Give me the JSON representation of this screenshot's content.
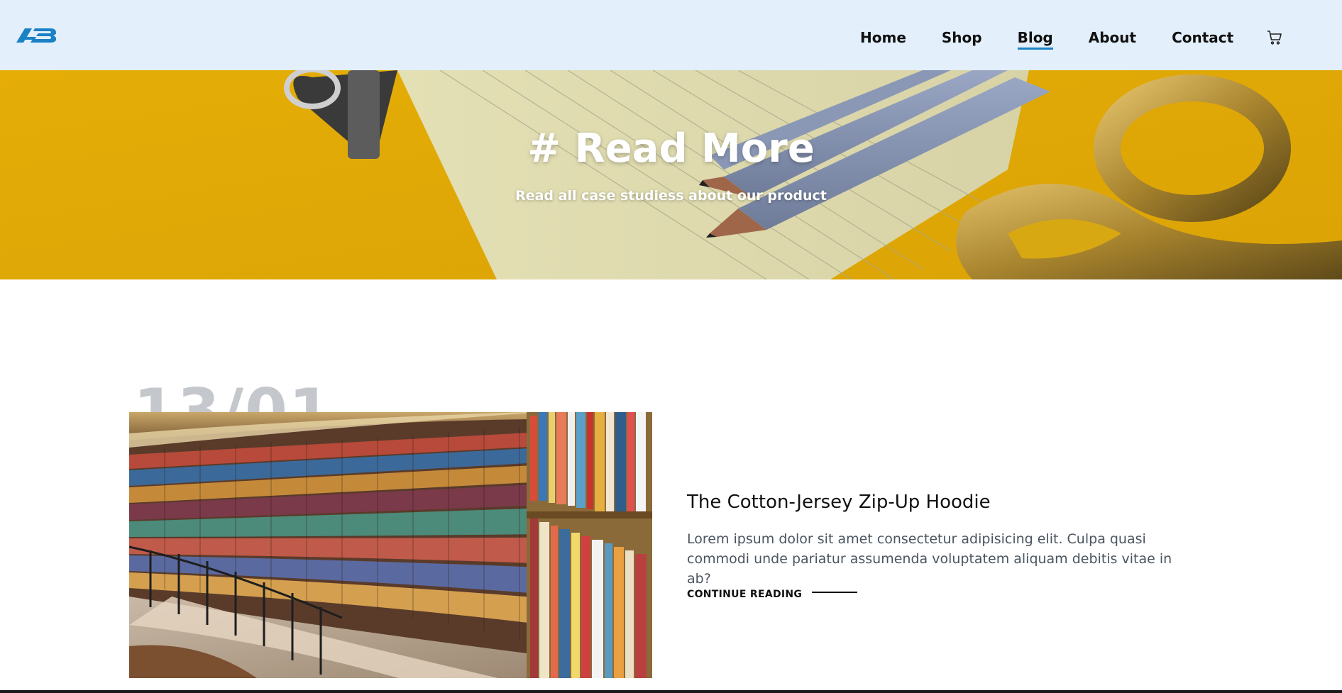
{
  "brand": {
    "logo_icon": "ab-logo-icon",
    "accent_color": "#1a82c4"
  },
  "nav": {
    "items": [
      {
        "label": "Home"
      },
      {
        "label": "Shop"
      },
      {
        "label": "Blog",
        "active": true
      },
      {
        "label": "About"
      },
      {
        "label": "Contact"
      }
    ],
    "cart_icon": "cart-icon"
  },
  "hero": {
    "title": "# Read More",
    "subtitle": "Read all case studiess about our product",
    "background_color": "#e8b30b"
  },
  "post": {
    "date": "13/01",
    "title": "The Cotton-Jersey Zip-Up Hoodie",
    "excerpt": "Lorem ipsum dolor sit amet consectetur adipisicing elit. Culpa quasi commodi unde pariatur assumenda voluptatem aliquam debitis vitae in ab?",
    "continue_label": "CONTINUE READING"
  }
}
